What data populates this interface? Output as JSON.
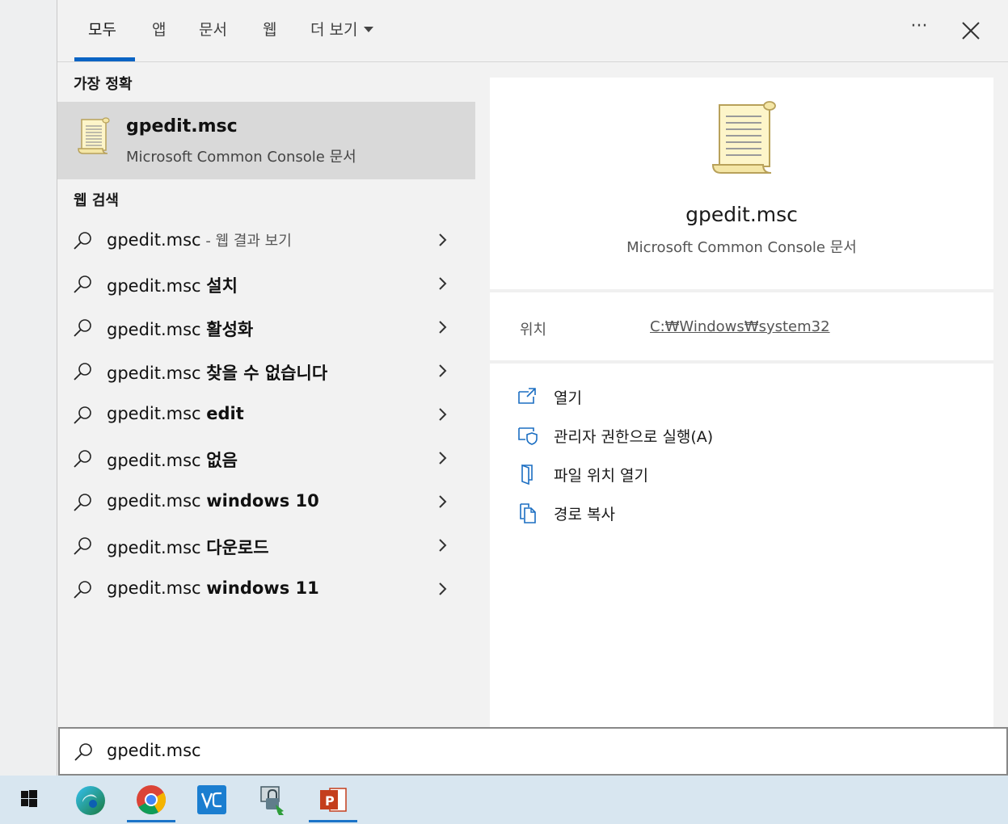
{
  "tabs": [
    {
      "label": "모두"
    },
    {
      "label": "앱"
    },
    {
      "label": "문서"
    },
    {
      "label": "웹"
    },
    {
      "label": "더 보기"
    }
  ],
  "more_label": "···",
  "best_match": {
    "section_label": "가장 정확",
    "title": "gpedit.msc",
    "subtitle": "Microsoft Common Console 문서"
  },
  "web_search": {
    "section_label": "웹 검색",
    "items": [
      {
        "prefix": "gpedit.msc",
        "bold": "",
        "suffix": " - 웹 결과 보기"
      },
      {
        "prefix": "gpedit.msc ",
        "bold": "설치",
        "suffix": ""
      },
      {
        "prefix": "gpedit.msc ",
        "bold": "활성화",
        "suffix": ""
      },
      {
        "prefix": "gpedit.msc ",
        "bold": "찾을 수 없습니다",
        "suffix": ""
      },
      {
        "prefix": "gpedit.msc ",
        "bold": "edit",
        "suffix": ""
      },
      {
        "prefix": "gpedit.msc ",
        "bold": "없음",
        "suffix": ""
      },
      {
        "prefix": "gpedit.msc ",
        "bold": "windows 10",
        "suffix": ""
      },
      {
        "prefix": "gpedit.msc ",
        "bold": "다운로드",
        "suffix": ""
      },
      {
        "prefix": "gpedit.msc ",
        "bold": "windows 11",
        "suffix": ""
      }
    ]
  },
  "preview": {
    "title": "gpedit.msc",
    "subtitle": "Microsoft Common Console 문서",
    "location_label": "위치",
    "location_value": "C:₩Windows₩system32",
    "actions": [
      {
        "label": "열기",
        "icon": "open-icon"
      },
      {
        "label": "관리자 권한으로 실행(A)",
        "icon": "run-as-admin-icon"
      },
      {
        "label": "파일 위치 열기",
        "icon": "open-file-location-icon"
      },
      {
        "label": "경로 복사",
        "icon": "copy-path-icon"
      }
    ]
  },
  "search": {
    "value": "gpedit.msc"
  },
  "taskbar": {
    "items": [
      "start-icon",
      "edge-icon",
      "chrome-icon",
      "vmware-icon",
      "network-lock-icon",
      "powerpoint-icon"
    ]
  },
  "colors": {
    "accent": "#0a64c4",
    "selected_bg": "#d9d9d9",
    "icon_blue": "#1b6ec2"
  }
}
